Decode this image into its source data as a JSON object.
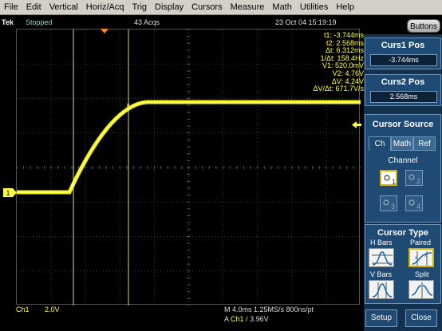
{
  "menu": [
    "File",
    "Edit",
    "Vertical",
    "Horiz/Acq",
    "Trig",
    "Display",
    "Cursors",
    "Measure",
    "Math",
    "Utilities",
    "Help"
  ],
  "status": {
    "brand": "Tek",
    "run_state": "Stopped",
    "acquisitions": "43 Acqs",
    "datetime": "23 Oct 04 15:19:19"
  },
  "buttons_label": "Buttons",
  "readout": [
    "t1: -3.744ms",
    "t2: 2.568ms",
    "Δt: 6.312ms",
    "1/Δt: 158.4Hz",
    "V1: 520.0mV",
    "V2: 4.76V",
    "ΔV: 4.24V",
    "ΔV/Δt: 671.7V/s"
  ],
  "channel_marker": "1",
  "bottom": {
    "ch1_label": "Ch1",
    "ch1_scale": "2.0V",
    "horiz": "M 4.0ms 1.25MS/s  800ns/pt",
    "trig_prefix": "A",
    "trig_channel": "Ch1",
    "trig_suffix": "/ 3.96V"
  },
  "panel": {
    "curs1_title": "Curs1 Pos",
    "curs1_value": "-3.744ms",
    "curs2_title": "Curs2 Pos",
    "curs2_value": "2.568ms",
    "source_title": "Cursor Source",
    "tabs": [
      "Ch",
      "Math",
      "Ref"
    ],
    "selected_tab": "Ch",
    "channel_label": "Channel",
    "channels": [
      "1",
      "2",
      "3",
      "4"
    ],
    "selected_channel": "1",
    "type_title": "Cursor Type",
    "types": [
      "H Bars",
      "Paired",
      "V Bars",
      "Split"
    ],
    "selected_type": "Paired",
    "setup_label": "Setup",
    "close_label": "Close"
  },
  "colors": {
    "trace": "#ffff00",
    "cursor": "#ffffa0",
    "panel_bg": "#14324f",
    "menubar_bg": "#d4d0c8"
  }
}
